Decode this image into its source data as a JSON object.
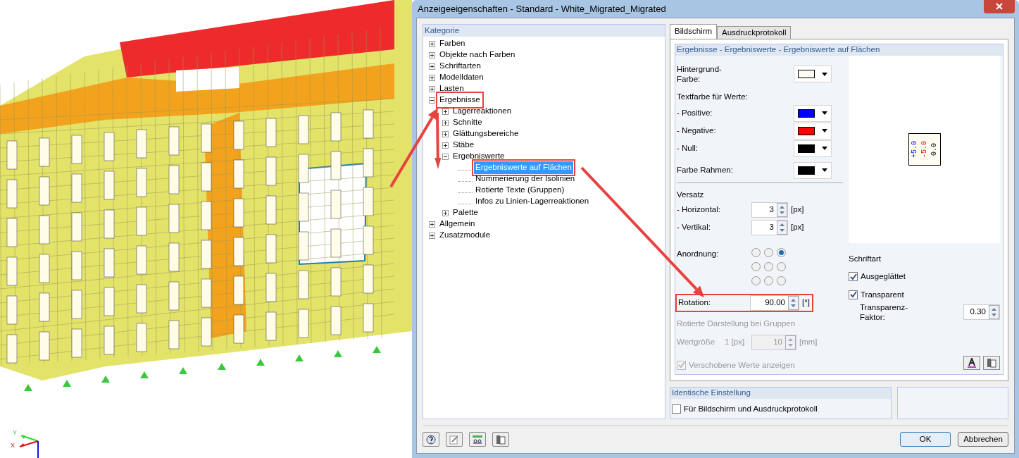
{
  "model_view": {
    "axes": [
      "Y",
      "X"
    ]
  },
  "window": {
    "title": "Anzeigeeigenschaften - Standard - White_Migrated_Migrated"
  },
  "category_panel": {
    "title": "Kategorie",
    "tree": [
      {
        "label": "Farben",
        "expanded": false,
        "selected": false,
        "highlighted": false
      },
      {
        "label": "Objekte nach Farben",
        "expanded": false,
        "selected": false,
        "highlighted": false
      },
      {
        "label": "Schriftarten",
        "expanded": false,
        "selected": false,
        "highlighted": false
      },
      {
        "label": "Modelldaten",
        "expanded": false,
        "selected": false,
        "highlighted": false
      },
      {
        "label": "Lasten",
        "expanded": false,
        "selected": false,
        "highlighted": false
      },
      {
        "label": "Ergebnisse",
        "expanded": true,
        "selected": false,
        "highlighted": true,
        "children": [
          {
            "label": "Lagerreaktionen",
            "expanded": false,
            "selected": false,
            "highlighted": false
          },
          {
            "label": "Schnitte",
            "expanded": false,
            "selected": false,
            "highlighted": false
          },
          {
            "label": "Glättungsbereiche",
            "expanded": false,
            "selected": false,
            "highlighted": false
          },
          {
            "label": "Stäbe",
            "expanded": false,
            "selected": false,
            "highlighted": false
          },
          {
            "label": "Ergebniswerte",
            "expanded": true,
            "selected": false,
            "highlighted": false,
            "children": [
              {
                "label": "Ergebniswerte auf Flächen",
                "selected": true,
                "highlighted": true
              },
              {
                "label": "Nummerierung der Isolinien",
                "selected": false,
                "highlighted": false
              },
              {
                "label": "Rotierte Texte (Gruppen)",
                "selected": false,
                "highlighted": false
              },
              {
                "label": "Infos zu Linien-Lagerreaktionen",
                "selected": false,
                "highlighted": false
              }
            ]
          },
          {
            "label": "Palette",
            "expanded": false,
            "selected": false,
            "highlighted": false
          }
        ]
      },
      {
        "label": "Allgemein",
        "expanded": false,
        "selected": false,
        "highlighted": false
      },
      {
        "label": "Zusatzmodule",
        "expanded": false,
        "selected": false,
        "highlighted": false
      }
    ]
  },
  "tabs": [
    {
      "label": "Bildschirm",
      "selected": true
    },
    {
      "label": "Ausdruckprotokoll",
      "selected": false
    }
  ],
  "section_title": "Ergebnisse - Ergebniswerte - Ergebniswerte auf Flächen",
  "background_color": {
    "label": "Hintergrund-Farbe:",
    "color": "#fffcf2"
  },
  "text_color_heading": "Textfarbe für Werte:",
  "text_colors": [
    {
      "label": "- Positive:",
      "color": "#0000ff"
    },
    {
      "label": "- Negative:",
      "color": "#ff0000"
    },
    {
      "label": "- Null:",
      "color": "#000000"
    }
  ],
  "frame_color": {
    "label": "Farbe Rahmen:",
    "color": "#000000"
  },
  "offset": {
    "heading": "Versatz",
    "rows": [
      {
        "label": "- Horizontal:",
        "value": "3",
        "unit": "[px]"
      },
      {
        "label": "- Vertikal:",
        "value": "3",
        "unit": "[px]"
      }
    ]
  },
  "arrangement": {
    "label": "Anordnung:",
    "options": [
      {
        "selected": false
      },
      {
        "selected": false
      },
      {
        "selected": true
      },
      {
        "selected": false
      },
      {
        "selected": false
      },
      {
        "selected": false
      },
      {
        "selected": false
      },
      {
        "selected": false
      },
      {
        "selected": false
      }
    ]
  },
  "rotation": {
    "label": "Rotation:",
    "value": "90.00",
    "unit": "[°]",
    "highlighted": true
  },
  "group_rotation": {
    "heading": "Rotierte Darstellung bei Gruppen",
    "label": "Wertgröße",
    "scale": "1 [px]",
    "value": "10",
    "unit": "[mm]",
    "disabled": true
  },
  "shifted_values": {
    "label": "Verschobene Werte anzeigen",
    "checked": true,
    "disabled": true
  },
  "preview": {
    "labels": [
      {
        "text": "+5.0",
        "kind": "positive"
      },
      {
        "text": "-5.0",
        "kind": "negative"
      },
      {
        "text": "0.0",
        "kind": "null"
      }
    ]
  },
  "font": {
    "heading": "Schriftart",
    "options": [
      {
        "label": "Ausgeglättet",
        "checked": true
      },
      {
        "label": "Transparent",
        "checked": true
      }
    ],
    "factor_label": "Transparenz-Faktor:",
    "factor_value": "0.30"
  },
  "identical": {
    "title": "Identische Einstellung",
    "option": {
      "label": "Für Bildschirm und Ausdruckprotokoll",
      "checked": false
    }
  },
  "buttons": [
    "OK",
    "Abbrechen"
  ]
}
